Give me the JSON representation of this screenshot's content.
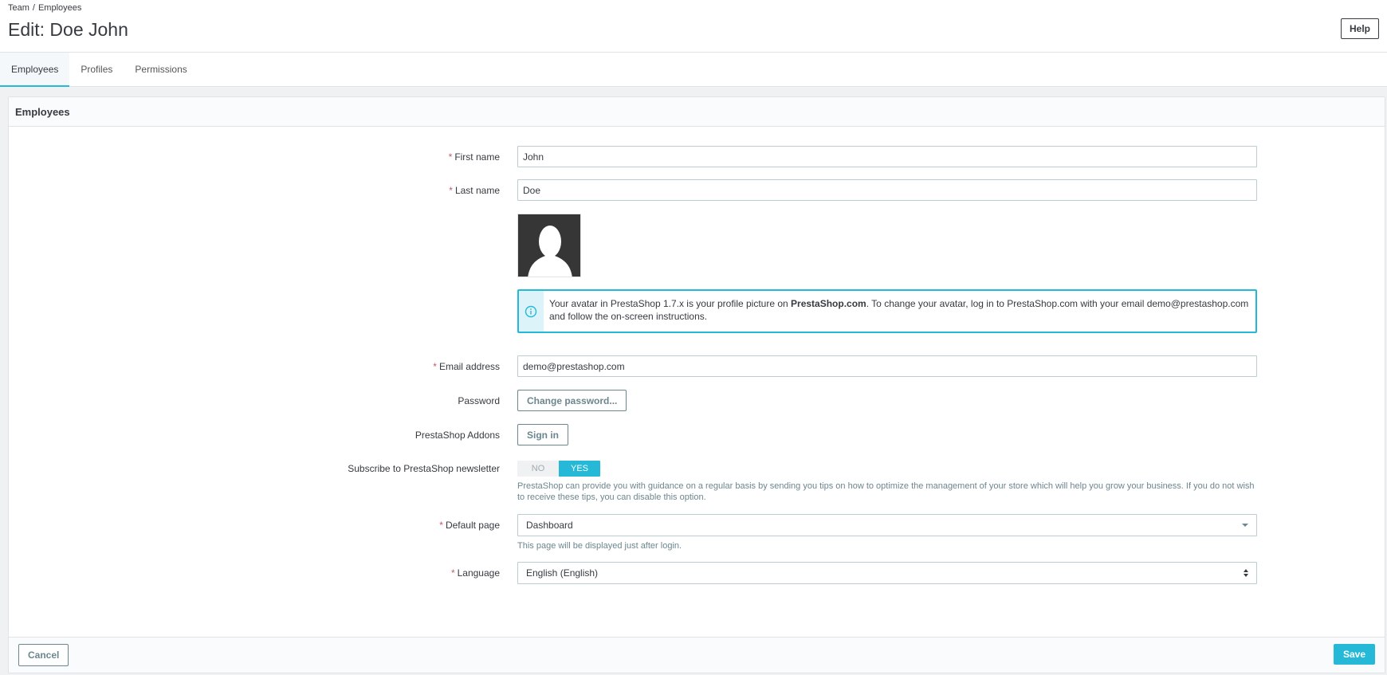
{
  "breadcrumb": [
    "Team",
    "Employees"
  ],
  "breadcrumb_sep": "/",
  "page_title": "Edit: Doe John",
  "help_label": "Help",
  "tabs": [
    {
      "label": "Employees",
      "active": true
    },
    {
      "label": "Profiles",
      "active": false
    },
    {
      "label": "Permissions",
      "active": false
    }
  ],
  "card": {
    "title": "Employees"
  },
  "form": {
    "required_mark": "*",
    "first_name": {
      "label": "First name",
      "value": "John"
    },
    "last_name": {
      "label": "Last name",
      "value": "Doe"
    },
    "avatar_alert": {
      "text_before": "Your avatar in PrestaShop 1.7.x is your profile picture on ",
      "text_bold": "PrestaShop.com",
      "text_after": ". To change your avatar, log in to PrestaShop.com with your email demo@prestashop.com and follow the on-screen instructions."
    },
    "email": {
      "label": "Email address",
      "value": "demo@prestashop.com"
    },
    "password": {
      "label": "Password",
      "button": "Change password..."
    },
    "addons": {
      "label": "PrestaShop Addons",
      "button": "Sign in"
    },
    "newsletter": {
      "label": "Subscribe to PrestaShop newsletter",
      "no": "NO",
      "yes": "YES",
      "selected": "YES",
      "help": "PrestaShop can provide you with guidance on a regular basis by sending you tips on how to optimize the management of your store which will help you grow your business. If you do not wish to receive these tips, you can disable this option."
    },
    "default_page": {
      "label": "Default page",
      "value": "Dashboard",
      "help": "This page will be displayed just after login."
    },
    "language": {
      "label": "Language",
      "value": "English (English)"
    }
  },
  "footer": {
    "cancel": "Cancel",
    "save": "Save"
  },
  "colors": {
    "accent": "#25b9d7",
    "required": "#c05c67",
    "text": "#363a41"
  }
}
